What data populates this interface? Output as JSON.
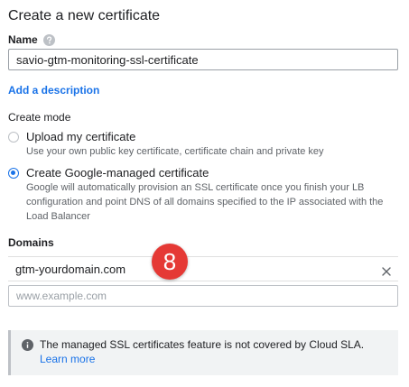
{
  "page": {
    "title": "Create a new certificate"
  },
  "name": {
    "label": "Name",
    "value": "savio-gtm-monitoring-ssl-certificate",
    "help_icon": "help-icon"
  },
  "description": {
    "link": "Add a description"
  },
  "create_mode": {
    "label": "Create mode",
    "options": [
      {
        "title": "Upload my certificate",
        "description": "Use your own public key certificate, certificate chain and private key",
        "selected": false
      },
      {
        "title": "Create Google-managed certificate",
        "description": "Google will automatically provision an SSL certificate once you finish your LB configuration and point DNS of all domains specified to the IP associated with the Load Balancer",
        "selected": true
      }
    ]
  },
  "domains": {
    "label": "Domains",
    "items": [
      "gtm-yourdomain.com"
    ],
    "input_placeholder": "www.example.com",
    "remove_icon": "close-icon"
  },
  "annotation": {
    "step_number": "8",
    "color": "#e53935"
  },
  "notice": {
    "icon": "info-icon",
    "text": "The managed SSL certificates feature is not covered by Cloud SLA.",
    "link": "Learn more"
  },
  "colors": {
    "accent": "#1a73e8",
    "text": "#202124",
    "muted": "#5f6368"
  }
}
